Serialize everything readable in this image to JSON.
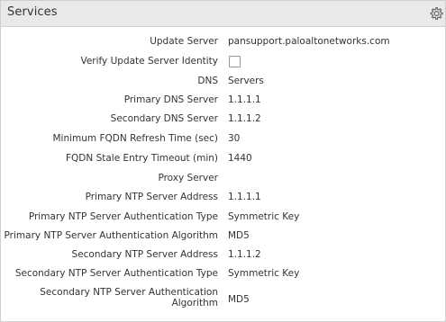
{
  "panel": {
    "title": "Services",
    "settings_icon": "gear-icon"
  },
  "fields": [
    {
      "label": "Update Server",
      "value": "pansupport.paloaltonetworks.com"
    },
    {
      "label": "Verify Update Server Identity",
      "type": "checkbox",
      "checked": false
    },
    {
      "label": "DNS",
      "value": "Servers"
    },
    {
      "label": "Primary DNS Server",
      "value": "1.1.1.1"
    },
    {
      "label": "Secondary DNS Server",
      "value": "1.1.1.2"
    },
    {
      "label": "Minimum FQDN Refresh Time (sec)",
      "value": "30"
    },
    {
      "label": "FQDN Stale Entry Timeout (min)",
      "value": "1440"
    },
    {
      "label": "Proxy Server",
      "value": ""
    },
    {
      "label": "Primary NTP Server Address",
      "value": "1.1.1.1"
    },
    {
      "label": "Primary NTP Server Authentication Type",
      "value": "Symmetric Key"
    },
    {
      "label": "Primary NTP Server Authentication Algorithm",
      "value": "MD5"
    },
    {
      "label": "Secondary NTP Server Address",
      "value": "1.1.1.2"
    },
    {
      "label": "Secondary NTP Server Authentication Type",
      "value": "Symmetric Key"
    },
    {
      "label_line1": "Secondary NTP Server Authentication",
      "label_line2": "Algorithm",
      "value": "MD5"
    }
  ]
}
